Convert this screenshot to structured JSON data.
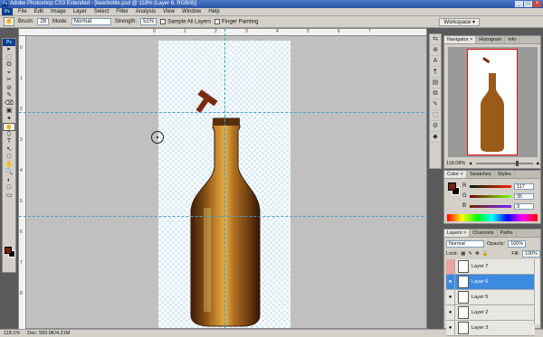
{
  "window": {
    "title": "Adobe Photoshop CS3 Extended - [beerbottle.psd @ 118% (Layer 6, RGB/8)]",
    "app_icon": "Ps",
    "buttons": [
      "_",
      "□",
      "×"
    ]
  },
  "menubar": {
    "logo": "Ps",
    "items": [
      "File",
      "Edit",
      "Image",
      "Layer",
      "Select",
      "Filter",
      "Analysis",
      "View",
      "Window",
      "Help"
    ]
  },
  "options": {
    "brush_label": "Brush:",
    "brush_size": "28",
    "mode_label": "Mode:",
    "mode_value": "Normal",
    "strength_label": "Strength:",
    "strength_value": "51%",
    "sample_all_layers": "Sample All Layers",
    "finger_painting": "Finger Painting",
    "workspace": "Workspace ▾"
  },
  "toolbox": {
    "badge": "Ps",
    "tools": [
      "▸",
      "⬚",
      "ʘ",
      "⌖",
      "✂",
      "⊘",
      "✎",
      "⌫",
      "▣",
      "✦",
      "☝",
      "⬯",
      "T",
      "↖",
      "□",
      "✋",
      "🔍",
      "◐",
      "□",
      "▭"
    ],
    "foreground_color": "#75230a",
    "background_color": "#000000"
  },
  "rulers": {
    "top": [
      "0",
      "1",
      "2",
      "3",
      "4",
      "5",
      "6",
      "7"
    ],
    "left": [
      "0",
      "1",
      "2",
      "3",
      "4",
      "5",
      "6",
      "7",
      "8"
    ]
  },
  "statusbar": {
    "zoom": "118.1%",
    "doc": "Doc: 560.0K/4.21M"
  },
  "navigator": {
    "tabs": [
      "Navigator ×",
      "Histogram",
      "Info"
    ],
    "zoom": "118.08%"
  },
  "color": {
    "tabs": [
      "Color ×",
      "Swatches",
      "Styles"
    ],
    "r_label": "R",
    "r_value": "117",
    "g_label": "G",
    "g_value": "35",
    "b_label": "B",
    "b_value": "3",
    "foreground": "#75230a"
  },
  "layers": {
    "tabs": [
      "Layers ×",
      "Channels",
      "Paths"
    ],
    "blend_mode": "Normal",
    "opacity_label": "Opacity:",
    "opacity_value": "100%",
    "lock_label": "Lock:",
    "fill_label": "Fill:",
    "fill_value": "100%",
    "items": [
      {
        "name": "Layer 7",
        "visible": false,
        "selected": false
      },
      {
        "name": "Layer 6",
        "visible": true,
        "selected": true
      },
      {
        "name": "Layer 5",
        "visible": true,
        "selected": false
      },
      {
        "name": "Layer 2",
        "visible": true,
        "selected": false
      },
      {
        "name": "Layer 3",
        "visible": true,
        "selected": false
      }
    ]
  },
  "dock": {
    "icons": [
      "⇆",
      "⊕",
      "A",
      "¶",
      "▤",
      "⧉",
      "✎",
      "⬚",
      "⚙",
      "◆"
    ]
  }
}
